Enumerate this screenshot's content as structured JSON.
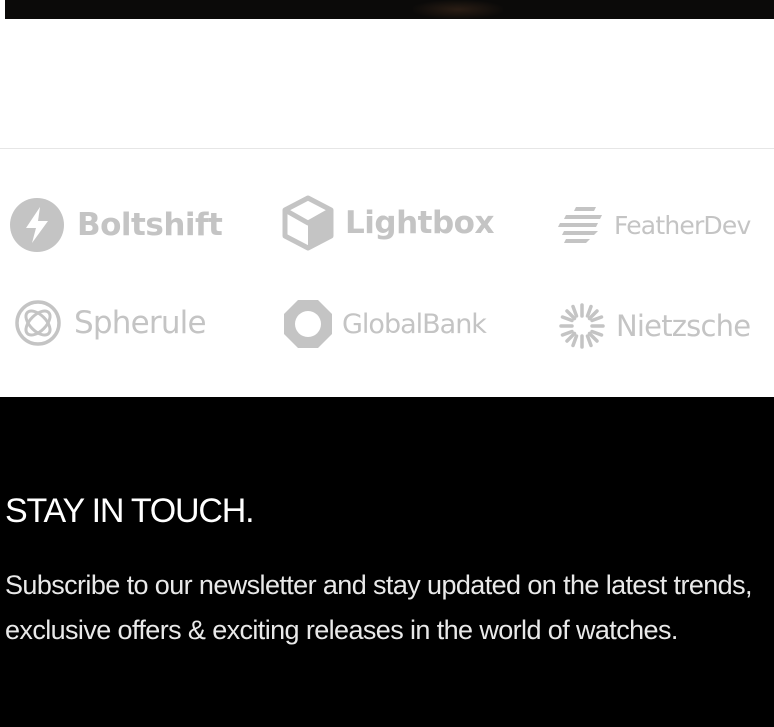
{
  "hero": {},
  "logos": {
    "items": [
      {
        "name": "Boltshift",
        "icon": "bolt-circle-icon"
      },
      {
        "name": "Lightbox",
        "icon": "cube-icon"
      },
      {
        "name": "FeatherDev",
        "icon": "feather-lines-icon"
      },
      {
        "name": "Spherule",
        "icon": "sphere-icon"
      },
      {
        "name": "GlobalBank",
        "icon": "octagon-ring-icon"
      },
      {
        "name": "Nietzsche",
        "icon": "starburst-icon"
      }
    ],
    "color": "#c4c4c4"
  },
  "newsletter": {
    "title": "STAY IN TOUCH.",
    "description": "Subscribe to our newsletter and stay updated on the latest trends, exclusive offers & exciting releases in the world of watches.",
    "background": "#000000"
  }
}
